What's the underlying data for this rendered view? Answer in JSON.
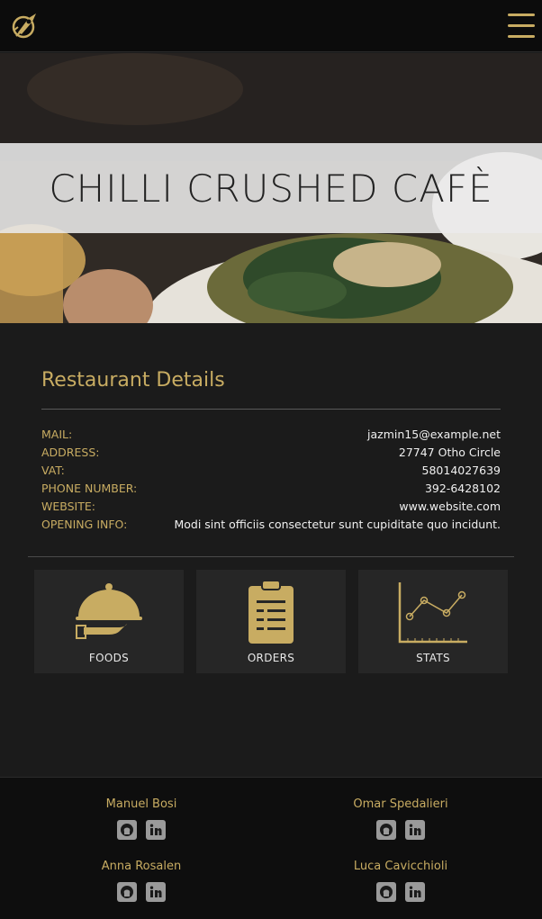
{
  "header": {
    "logo_icon": "rocket-logo-icon",
    "menu_icon": "hamburger-menu-icon"
  },
  "hero": {
    "title": "CHILLI CRUSHED CAFÈ"
  },
  "details": {
    "title": "Restaurant Details",
    "rows": [
      {
        "label": "MAIL:",
        "value": "jazmin15@example.net"
      },
      {
        "label": "ADDRESS:",
        "value": "27747 Otho Circle"
      },
      {
        "label": "VAT:",
        "value": "58014027639"
      },
      {
        "label": "PHONE NUMBER:",
        "value": "392-6428102"
      },
      {
        "label": "WEBSITE:",
        "value": "www.website.com"
      },
      {
        "label": "OPENING INFO:",
        "value": "Modi sint officiis consectetur sunt cupiditate quo incidunt."
      }
    ]
  },
  "cards": [
    {
      "label": "FOODS",
      "icon": "cloche-serving-icon"
    },
    {
      "label": "ORDERS",
      "icon": "clipboard-icon"
    },
    {
      "label": "STATS",
      "icon": "line-chart-icon"
    }
  ],
  "footer": {
    "members": [
      {
        "name": "Manuel Bosi"
      },
      {
        "name": "Omar Spedalieri"
      },
      {
        "name": "Anna Rosalen"
      },
      {
        "name": "Luca Cavicchioli"
      }
    ]
  },
  "colors": {
    "accent": "#c8ac62",
    "background": "#1b1b1b",
    "card": "#262626",
    "footer": "#0e0e0e"
  }
}
